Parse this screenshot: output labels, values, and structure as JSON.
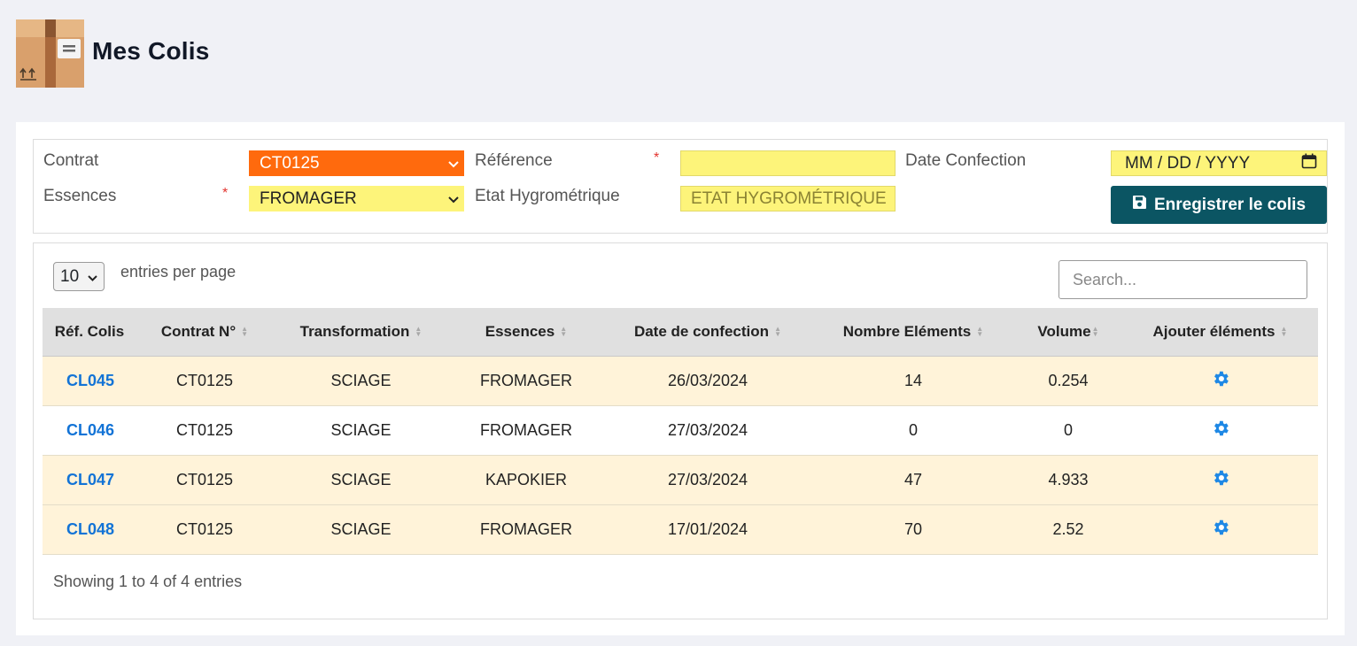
{
  "page": {
    "title": "Mes Colis",
    "icon": "package-icon"
  },
  "form": {
    "contrat": {
      "label": "Contrat",
      "value": "CT0125"
    },
    "reference": {
      "label": "Référence",
      "required_mark": "*",
      "value": ""
    },
    "date_confection": {
      "label": "Date Confection",
      "placeholder": "MM / DD / YYYY"
    },
    "essences": {
      "label": "Essences",
      "required_mark": "*",
      "value": "FROMAGER"
    },
    "etat": {
      "label": "Etat Hygrométrique",
      "placeholder": "ETAT HYGROMÉTRIQUE"
    },
    "save_button": {
      "label": "Enregistrer le colis",
      "icon": "floppy-disk-icon"
    }
  },
  "table_controls": {
    "per_page_value": "10",
    "per_page_text": "entries per page",
    "search_placeholder": "Search..."
  },
  "columns": [
    "Réf. Colis",
    "Contrat N°",
    "Transformation",
    "Essences",
    "Date de confection",
    "Nombre Eléments",
    "Volume",
    "Ajouter éléments"
  ],
  "rows": [
    {
      "ref": "CL045",
      "contrat": "CT0125",
      "transformation": "SCIAGE",
      "essence": "FROMAGER",
      "date": "26/03/2024",
      "nombre": "14",
      "volume": "0.254",
      "action_icon": "gear-icon"
    },
    {
      "ref": "CL046",
      "contrat": "CT0125",
      "transformation": "SCIAGE",
      "essence": "FROMAGER",
      "date": "27/03/2024",
      "nombre": "0",
      "volume": "0",
      "action_icon": "gear-icon"
    },
    {
      "ref": "CL047",
      "contrat": "CT0125",
      "transformation": "SCIAGE",
      "essence": "KAPOKIER",
      "date": "27/03/2024",
      "nombre": "47",
      "volume": "4.933",
      "action_icon": "gear-icon"
    },
    {
      "ref": "CL048",
      "contrat": "CT0125",
      "transformation": "SCIAGE",
      "essence": "FROMAGER",
      "date": "17/01/2024",
      "nombre": "70",
      "volume": "2.52",
      "action_icon": "gear-icon"
    }
  ],
  "info": "Showing 1 to 4 of 4 entries",
  "colors": {
    "accent": "#0b5563",
    "selected": "#ff6a0d",
    "field": "#fdf47a",
    "link": "#1273d6",
    "row_highlight": "#fff3d9"
  }
}
